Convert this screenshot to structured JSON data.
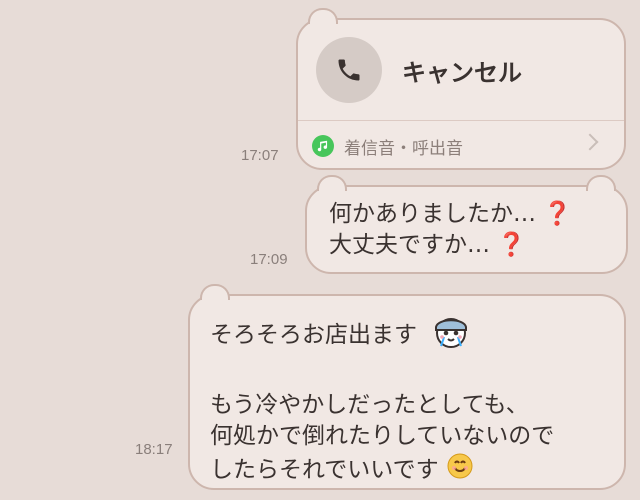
{
  "messages": {
    "call": {
      "title": "キャンセル",
      "ringtone_label": "着信音・呼出音",
      "time": "17:07"
    },
    "question": {
      "line1": "何かありましたか…",
      "line2": "大丈夫ですか…",
      "time": "17:09"
    },
    "leaving": {
      "line1": "そろそろお店出ます",
      "line3": "もう冷やかしだったとしても、",
      "line4": "何処かで倒れたりしていないので",
      "line5": "したらそれでいいです",
      "time": "18:17"
    }
  },
  "icons": {
    "call": "phone-icon",
    "ringtone": "music-note-icon",
    "question": "red-question-mark-emoji",
    "sticker": "crying-character-sticker",
    "smile": "smiling-face-emoji"
  },
  "colors": {
    "background": "#e7dcd7",
    "bubble": "#f1e8e4",
    "bubble_border": "#cdb6ad",
    "music_badge": "#47c65b",
    "question_mark": "#d23a3a"
  }
}
